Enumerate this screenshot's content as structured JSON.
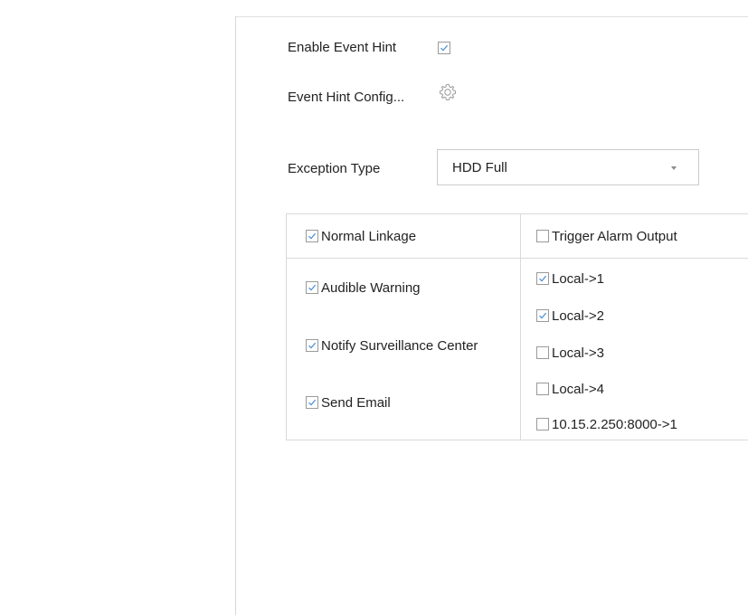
{
  "event_hint": {
    "enable_label": "Enable Event Hint",
    "enable_checked": true,
    "config_label": "Event Hint Config...",
    "config_icon": "gear-icon"
  },
  "exception": {
    "label": "Exception Type",
    "selected": "HDD Full"
  },
  "linkage_table": {
    "normal_linkage": {
      "header_label": "Normal Linkage",
      "header_checked": true,
      "items": [
        {
          "label": "Audible Warning",
          "checked": true
        },
        {
          "label": "Notify Surveillance Center",
          "checked": true
        },
        {
          "label": "Send Email",
          "checked": true
        }
      ]
    },
    "trigger_alarm_output": {
      "header_label": "Trigger Alarm Output",
      "header_checked": false,
      "items": [
        {
          "label": "Local->1",
          "checked": true
        },
        {
          "label": "Local->2",
          "checked": true
        },
        {
          "label": "Local->3",
          "checked": false
        },
        {
          "label": "Local->4",
          "checked": false
        },
        {
          "label": "10.15.2.250:8000->1",
          "checked": false
        }
      ]
    }
  },
  "colors": {
    "checkmark": "#4a8fd6",
    "border": "#d9d9d9",
    "text": "#222222"
  }
}
